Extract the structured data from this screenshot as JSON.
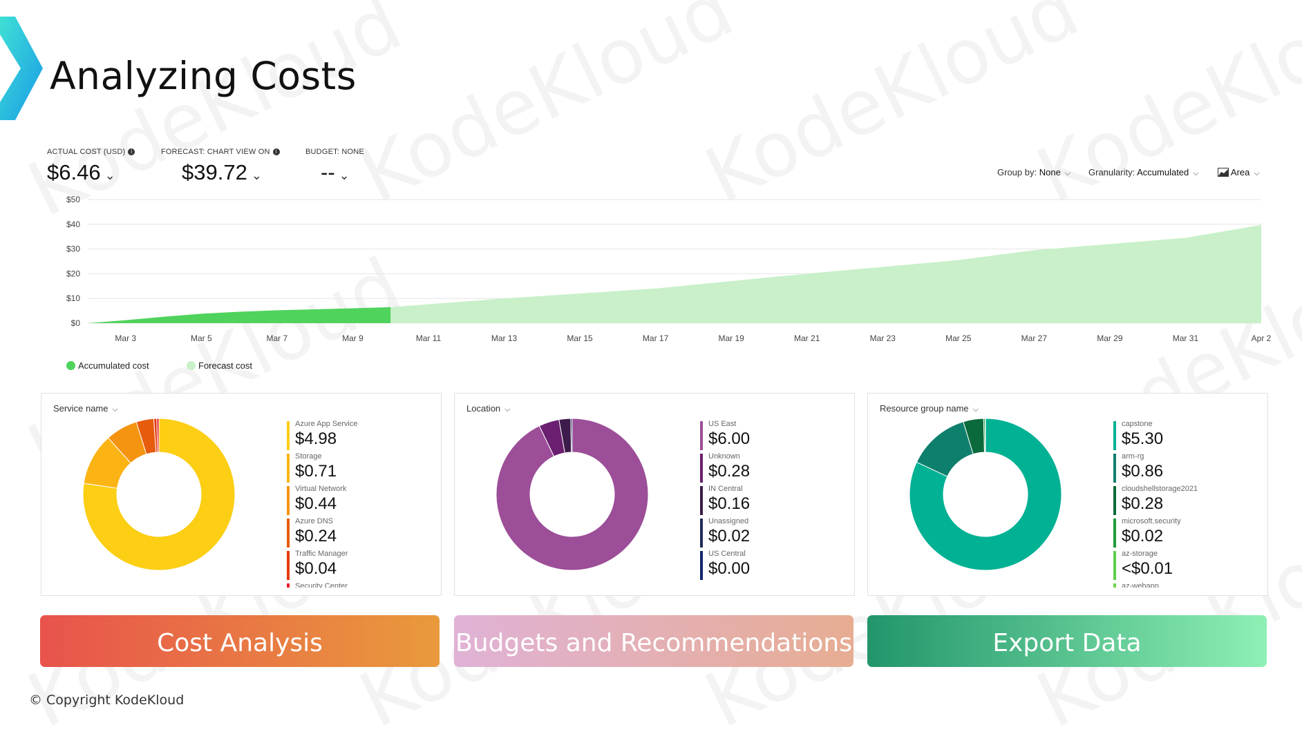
{
  "header": {
    "title": "Analyzing Costs"
  },
  "watermark": "KodeKloud",
  "kpis": {
    "actual": {
      "label": "ACTUAL COST (USD)",
      "value": "$6.46"
    },
    "forecast": {
      "label": "FORECAST: CHART VIEW ON",
      "value": "$39.72"
    },
    "budget": {
      "label": "BUDGET: NONE",
      "value": "--"
    }
  },
  "controls": {
    "group_by_label": "Group by:",
    "group_by_value": "None",
    "granularity_label": "Granularity:",
    "granularity_value": "Accumulated",
    "chart_type": "Area"
  },
  "chart_data": {
    "type": "area",
    "title": "",
    "y_ticks": [
      "$50",
      "$40",
      "$30",
      "$20",
      "$10",
      "$0"
    ],
    "ylim": [
      0,
      50
    ],
    "x_labels": [
      "Mar 3",
      "Mar 5",
      "Mar 7",
      "Mar 9",
      "Mar 11",
      "Mar 13",
      "Mar 15",
      "Mar 17",
      "Mar 19",
      "Mar 21",
      "Mar 23",
      "Mar 25",
      "Mar 27",
      "Mar 29",
      "Mar 31",
      "Apr 2"
    ],
    "grid": true,
    "legend_position": "bottom-left",
    "series": [
      {
        "name": "Accumulated cost",
        "color": "#4fd35c",
        "points": [
          [
            "Mar 2",
            0
          ],
          [
            "Mar 3",
            1.2
          ],
          [
            "Mar 4",
            2.6
          ],
          [
            "Mar 5",
            3.8
          ],
          [
            "Mar 6",
            4.6
          ],
          [
            "Mar 7",
            5.2
          ],
          [
            "Mar 8",
            5.6
          ],
          [
            "Mar 9",
            6.0
          ],
          [
            "Mar 10",
            6.46
          ]
        ]
      },
      {
        "name": "Forecast cost",
        "color": "#c9f0c9",
        "points": [
          [
            "Mar 10",
            6.46
          ],
          [
            "Mar 13",
            10.0
          ],
          [
            "Mar 17",
            14.0
          ],
          [
            "Mar 21",
            20.0
          ],
          [
            "Mar 25",
            25.5
          ],
          [
            "Mar 27",
            29.5
          ],
          [
            "Mar 31",
            34.5
          ],
          [
            "Apr 2",
            39.72
          ]
        ]
      }
    ]
  },
  "legend": {
    "accumulated": "Accumulated cost",
    "forecast": "Forecast cost"
  },
  "panels": [
    {
      "title": "Service name",
      "slices": [
        {
          "name": "Azure App Service",
          "value": 4.98,
          "label": "$4.98",
          "color": "#fcce14"
        },
        {
          "name": "Storage",
          "value": 0.71,
          "label": "$0.71",
          "color": "#fbb413"
        },
        {
          "name": "Virtual Network",
          "value": 0.44,
          "label": "$0.44",
          "color": "#f59410"
        },
        {
          "name": "Azure DNS",
          "value": 0.24,
          "label": "$0.24",
          "color": "#e65c0c"
        },
        {
          "name": "Traffic Manager",
          "value": 0.04,
          "label": "$0.04",
          "color": "#e53a10"
        },
        {
          "name": "Security Center",
          "value": 0.03,
          "label": "",
          "color": "#e8202a"
        }
      ]
    },
    {
      "title": "Location",
      "slices": [
        {
          "name": "US East",
          "value": 6.0,
          "label": "$6.00",
          "color": "#9c4e98"
        },
        {
          "name": "Unknown",
          "value": 0.28,
          "label": "$0.28",
          "color": "#6a1f70"
        },
        {
          "name": "IN Central",
          "value": 0.16,
          "label": "$0.16",
          "color": "#3d1b4a"
        },
        {
          "name": "Unassigned",
          "value": 0.02,
          "label": "$0.02",
          "color": "#1f2a5a"
        },
        {
          "name": "US Central",
          "value": 0.0,
          "label": "$0.00",
          "color": "#14256e"
        }
      ]
    },
    {
      "title": "Resource group name",
      "slices": [
        {
          "name": "capstone",
          "value": 5.3,
          "label": "$5.30",
          "color": "#00b193"
        },
        {
          "name": "arm-rg",
          "value": 0.86,
          "label": "$0.86",
          "color": "#0f7f6d"
        },
        {
          "name": "cloudshellstorage2021",
          "value": 0.28,
          "label": "$0.28",
          "color": "#0b6a3c"
        },
        {
          "name": "microsoft.security",
          "value": 0.02,
          "label": "$0.02",
          "color": "#1e9b3a"
        },
        {
          "name": "az-storage",
          "value": 0.005,
          "label": "<$0.01",
          "color": "#5fcf4a"
        },
        {
          "name": "az-webapp",
          "value": 0.0,
          "label": "",
          "color": "#6fd64a"
        }
      ]
    }
  ],
  "buttons": {
    "cost_analysis": "Cost Analysis",
    "budgets": "Budgets and Recommendations",
    "export": "Export Data"
  },
  "footer": {
    "copyright": "© Copyright KodeKloud"
  }
}
